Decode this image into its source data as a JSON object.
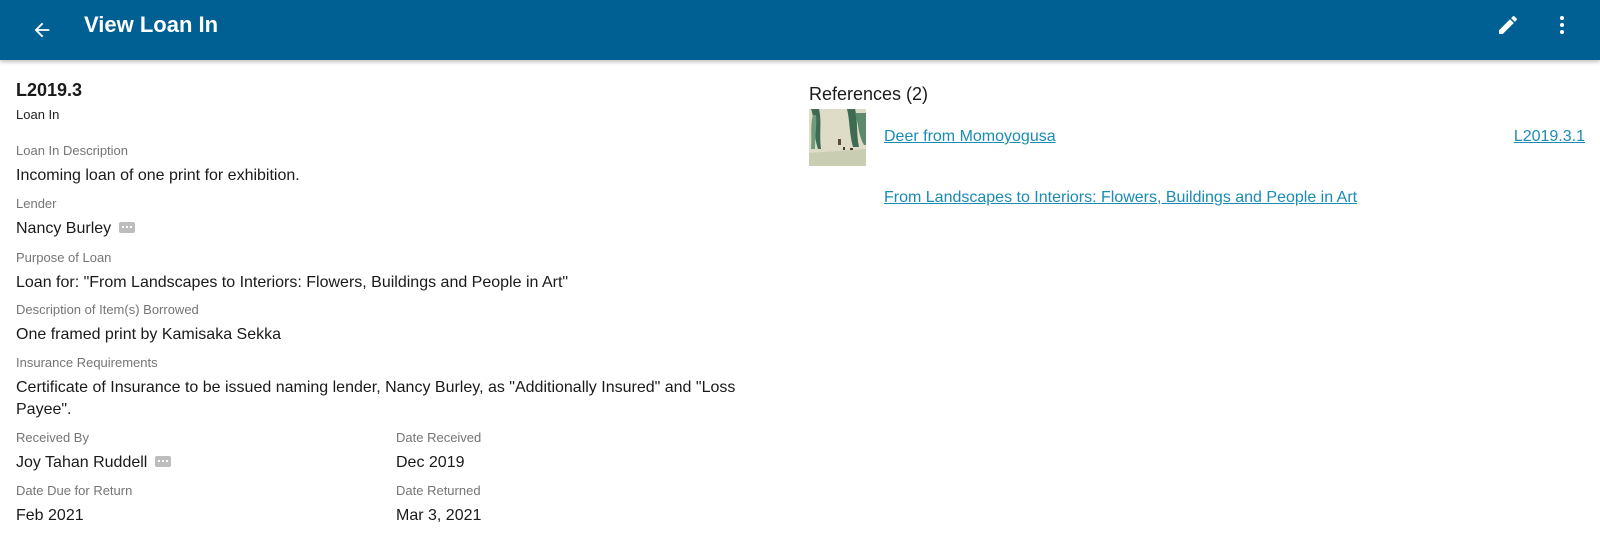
{
  "appbar": {
    "title": "View Loan In",
    "back_icon": "arrow-back-icon",
    "edit_icon": "pencil-icon",
    "more_icon": "more-vert-icon",
    "color": "#006094"
  },
  "record": {
    "id": "L2019.3",
    "type": "Loan In"
  },
  "fields": {
    "description": {
      "label": "Loan In Description",
      "value": "Incoming loan of one print for exhibition."
    },
    "lender": {
      "label": "Lender",
      "value": "Nancy Burley"
    },
    "purpose": {
      "label": "Purpose of Loan",
      "value": "Loan for: \"From Landscapes to Interiors: Flowers, Buildings and People in Art\""
    },
    "items": {
      "label": "Description of Item(s) Borrowed",
      "value": "One framed print by Kamisaka Sekka"
    },
    "insurance": {
      "label": "Insurance Requirements",
      "value": "Certificate of Insurance to be issued naming lender, Nancy Burley, as \"Additionally Insured\" and \"Loss Payee\"."
    },
    "received_by": {
      "label": "Received By",
      "value": "Joy Tahan Ruddell"
    },
    "date_received": {
      "label": "Date Received",
      "value": "Dec 2019"
    },
    "date_due": {
      "label": "Date Due for Return",
      "value": "Feb 2021"
    },
    "date_returned": {
      "label": "Date Returned",
      "value": "Mar 3, 2021"
    }
  },
  "references": {
    "title": "References (2)",
    "items": [
      {
        "label": "Deer from Momoyogusa",
        "code": "L2019.3.1"
      },
      {
        "label": "From Landscapes to Interiors: Flowers, Buildings and People in Art"
      }
    ]
  },
  "colors": {
    "link": "#1a8bb5",
    "label": "#757575"
  }
}
